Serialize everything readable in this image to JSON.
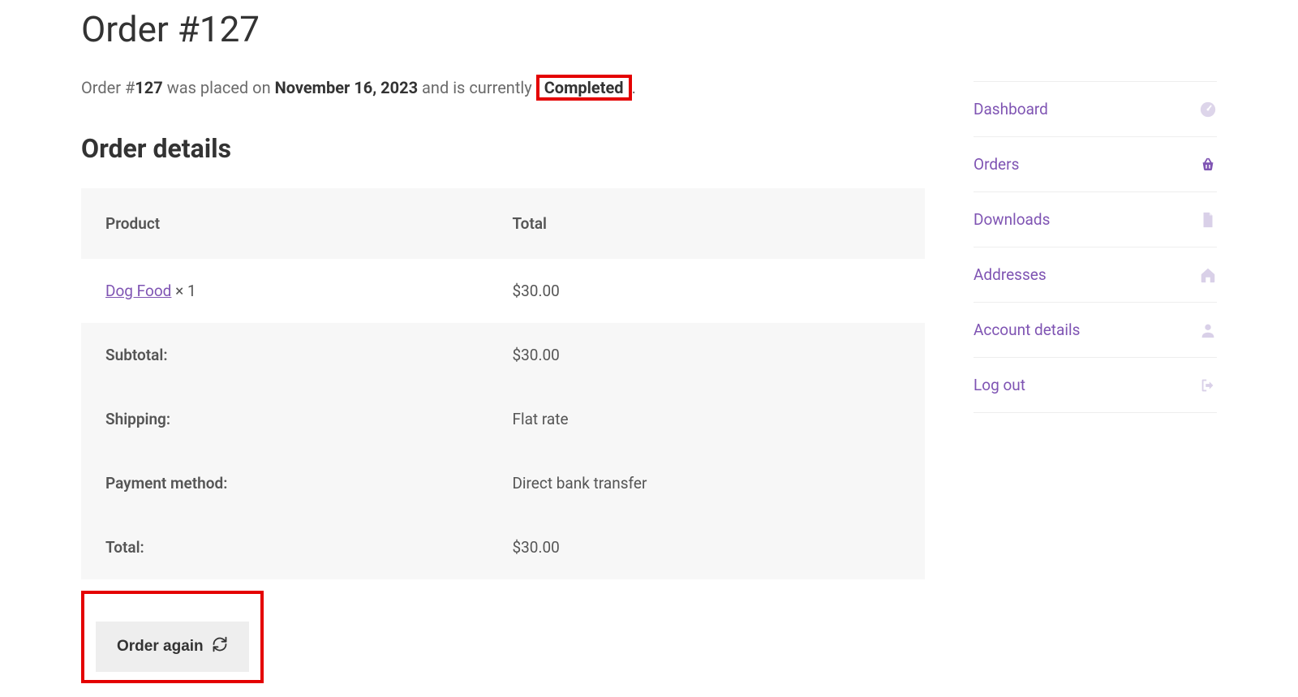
{
  "header": {
    "title": "Order #127"
  },
  "summary": {
    "prefix": "Order #",
    "order_number": "127",
    "placed_text": " was placed on ",
    "date": "November 16, 2023",
    "status_prefix": " and is currently ",
    "status": "Completed",
    "period": "."
  },
  "details": {
    "heading": "Order details",
    "columns": {
      "product": "Product",
      "total": "Total"
    },
    "line_item": {
      "product_name": "Dog Food",
      "qty_text": " × 1",
      "total": "$30.00"
    },
    "rows": {
      "subtotal": {
        "label": "Subtotal:",
        "value": "$30.00"
      },
      "shipping": {
        "label": "Shipping:",
        "value": "Flat rate"
      },
      "payment": {
        "label": "Payment method:",
        "value": "Direct bank transfer"
      },
      "total": {
        "label": "Total:",
        "value": "$30.00"
      }
    }
  },
  "actions": {
    "order_again": "Order again"
  },
  "sidebar": {
    "items": [
      {
        "label": "Dashboard"
      },
      {
        "label": "Orders"
      },
      {
        "label": "Downloads"
      },
      {
        "label": "Addresses"
      },
      {
        "label": "Account details"
      },
      {
        "label": "Log out"
      }
    ]
  }
}
